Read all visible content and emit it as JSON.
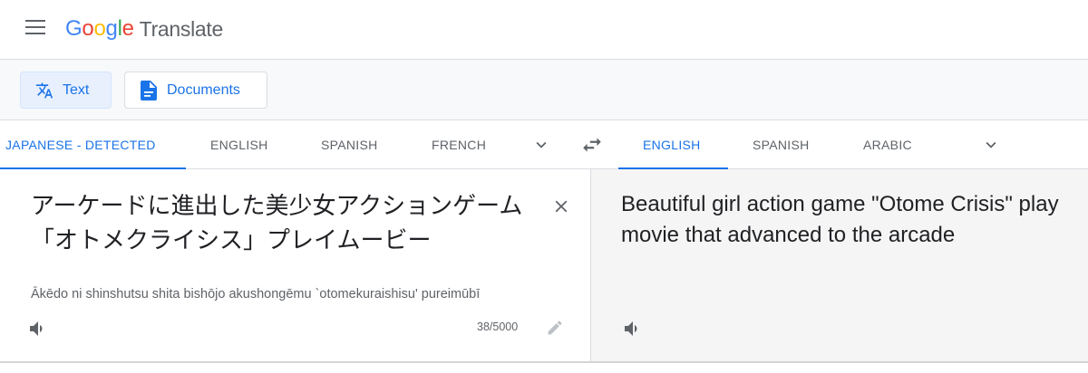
{
  "header": {
    "logo_letters": [
      "G",
      "o",
      "o",
      "g",
      "l",
      "e"
    ],
    "product": "Translate"
  },
  "modes": [
    {
      "label": "Text",
      "icon": "translate-icon",
      "active": true
    },
    {
      "label": "Documents",
      "icon": "document-icon",
      "active": false
    }
  ],
  "source_languages": [
    "JAPANESE - DETECTED",
    "ENGLISH",
    "SPANISH",
    "FRENCH"
  ],
  "target_languages": [
    "ENGLISH",
    "SPANISH",
    "ARABIC"
  ],
  "source": {
    "text": "アーケードに進出した美少女アクションゲーム「オトメクライシス」プレイムービー",
    "romanization": "Ākēdo ni shinshutsu shita bishōjo akushongēmu `otomekuraishisu' pureimūbī",
    "char_count": "38/5000"
  },
  "target": {
    "text": "Beautiful girl action game \"Otome Crisis\" play movie that advanced to the arcade"
  },
  "colors": {
    "accent": "#1a73e8",
    "target_bg": "#f5f5f5"
  }
}
